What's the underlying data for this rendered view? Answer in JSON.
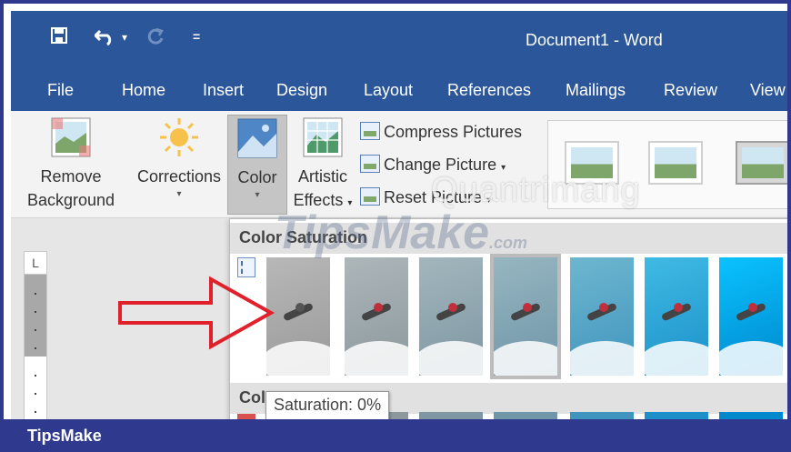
{
  "window": {
    "title": "Document1  -  Word"
  },
  "qat": {
    "save_icon": "save-icon",
    "undo_icon": "undo-icon",
    "redo_icon": "redo-icon",
    "customize_icon": "customize-qat-icon",
    "undo_dropdown": "▾",
    "customize": "="
  },
  "tabs": [
    "File",
    "Home",
    "Insert",
    "Design",
    "Layout",
    "References",
    "Mailings",
    "Review",
    "View"
  ],
  "ribbon": {
    "remove_background": {
      "line1": "Remove",
      "line2": "Background"
    },
    "corrections": {
      "label": "Corrections"
    },
    "color": {
      "label": "Color"
    },
    "artistic_effects": {
      "line1": "Artistic",
      "line2": "Effects"
    },
    "compress_pictures": "Compress Pictures",
    "change_picture": "Change Picture",
    "reset_picture": "Reset Picture",
    "caret": "▾"
  },
  "ruler": {
    "corner": "L"
  },
  "dropdown": {
    "section_saturation": "Color Saturation",
    "section_tone": "Color Tone",
    "tooltip": "Saturation: 0%",
    "saturation_thumbs": [
      {
        "saturation": 0,
        "selected": false
      },
      {
        "saturation": 33,
        "selected": false
      },
      {
        "saturation": 66,
        "selected": false
      },
      {
        "saturation": 100,
        "selected": true
      },
      {
        "saturation": 200,
        "selected": false
      },
      {
        "saturation": 300,
        "selected": false
      },
      {
        "saturation": 400,
        "selected": false
      }
    ]
  },
  "watermarks": {
    "tipsmake": "TipsMake",
    "tipsmake_domain": ".com",
    "quantrimang": "Quantrimang"
  },
  "footer": {
    "brand": "TipsMake"
  },
  "colors": {
    "title_bar": "#2b579a",
    "footer": "#2f3a8f",
    "arrow": "#e0202a"
  }
}
